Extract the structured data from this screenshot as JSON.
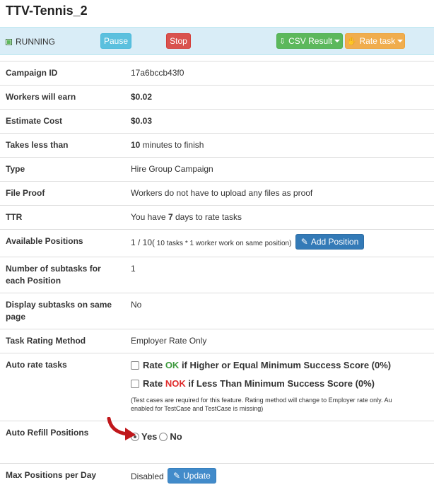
{
  "page": {
    "title": "TTV-Tennis_2"
  },
  "status_bar": {
    "status": "RUNNING",
    "pause_label": "Pause",
    "stop_label": "Stop",
    "csv_label": "CSV Result",
    "rate_label": "Rate task"
  },
  "details": {
    "campaign_id": {
      "label": "Campaign ID",
      "value": "17a6bccb43f0"
    },
    "workers_earn": {
      "label": "Workers will earn",
      "value": "$0.02"
    },
    "estimate_cost": {
      "label": "Estimate Cost",
      "value": "$0.03"
    },
    "takes_less": {
      "label": "Takes less than",
      "value_num": "10",
      "value_suffix": "minutes to finish"
    },
    "type": {
      "label": "Type",
      "value": "Hire Group Campaign"
    },
    "file_proof": {
      "label": "File Proof",
      "value": "Workers do not have to upload any files as proof"
    },
    "ttr": {
      "label": "TTR",
      "prefix": "You have",
      "days": "7",
      "suffix": "days to rate tasks"
    },
    "available_positions": {
      "label": "Available Positions",
      "value": "1 / 10(",
      "detail": " 10 tasks * 1 worker work on same position)",
      "add_button": "Add Position"
    },
    "subtasks_per_position": {
      "label": "Number of subtasks for each Position",
      "value": "1"
    },
    "display_subtasks": {
      "label": "Display subtasks on same page",
      "value": "No"
    },
    "rating_method": {
      "label": "Task Rating Method",
      "value": "Employer Rate Only"
    },
    "auto_rate": {
      "label": "Auto rate tasks",
      "ok_prefix": "Rate",
      "ok_word": "OK",
      "ok_suffix": "if Higher or Equal Minimum Success Score (0%)",
      "nok_prefix": "Rate",
      "nok_word": "NOK",
      "nok_suffix": "if Less Than Minimum Success Score (0%)",
      "note_line1": "(Test cases are required for this feature. Rating method will change to Employer rate only. Au",
      "note_line2": "enabled for TestCase and TestCase is missing)"
    },
    "auto_refill": {
      "label": "Auto Refill Positions",
      "yes": "Yes",
      "no": "No",
      "selected": "Yes"
    },
    "max_per_day": {
      "label": "Max Positions per Day",
      "value": "Disabled",
      "update_button": "Update"
    }
  },
  "colors": {
    "status_bar_bg": "#d9edf7",
    "pause": "#5bc0de",
    "stop": "#d9534f",
    "csv": "#5cb85c",
    "rate": "#f0ad4e",
    "primary": "#337ab7",
    "ok": "#3c9a3c",
    "nok": "#e02c2c",
    "arrow": "#c0171b"
  }
}
